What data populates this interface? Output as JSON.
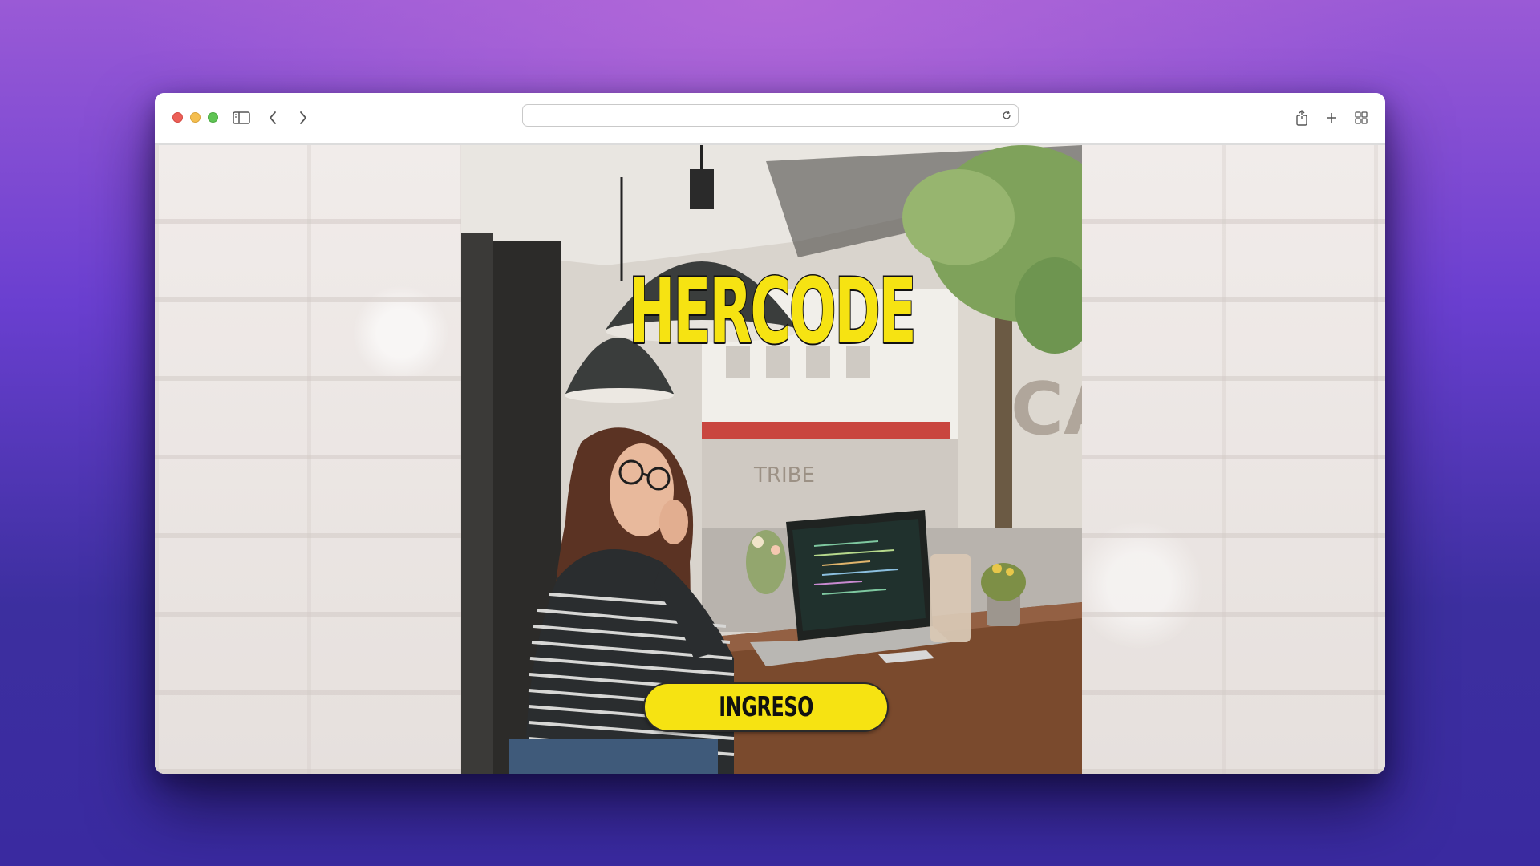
{
  "browser": {
    "address_value": "",
    "address_placeholder": ""
  },
  "hero": {
    "title": "HERCODE",
    "cta_label": "INGRESO"
  },
  "colors": {
    "accent_yellow": "#f6e312",
    "desktop_top": "#9a5ad6",
    "desktop_bottom": "#3a2aa0"
  }
}
